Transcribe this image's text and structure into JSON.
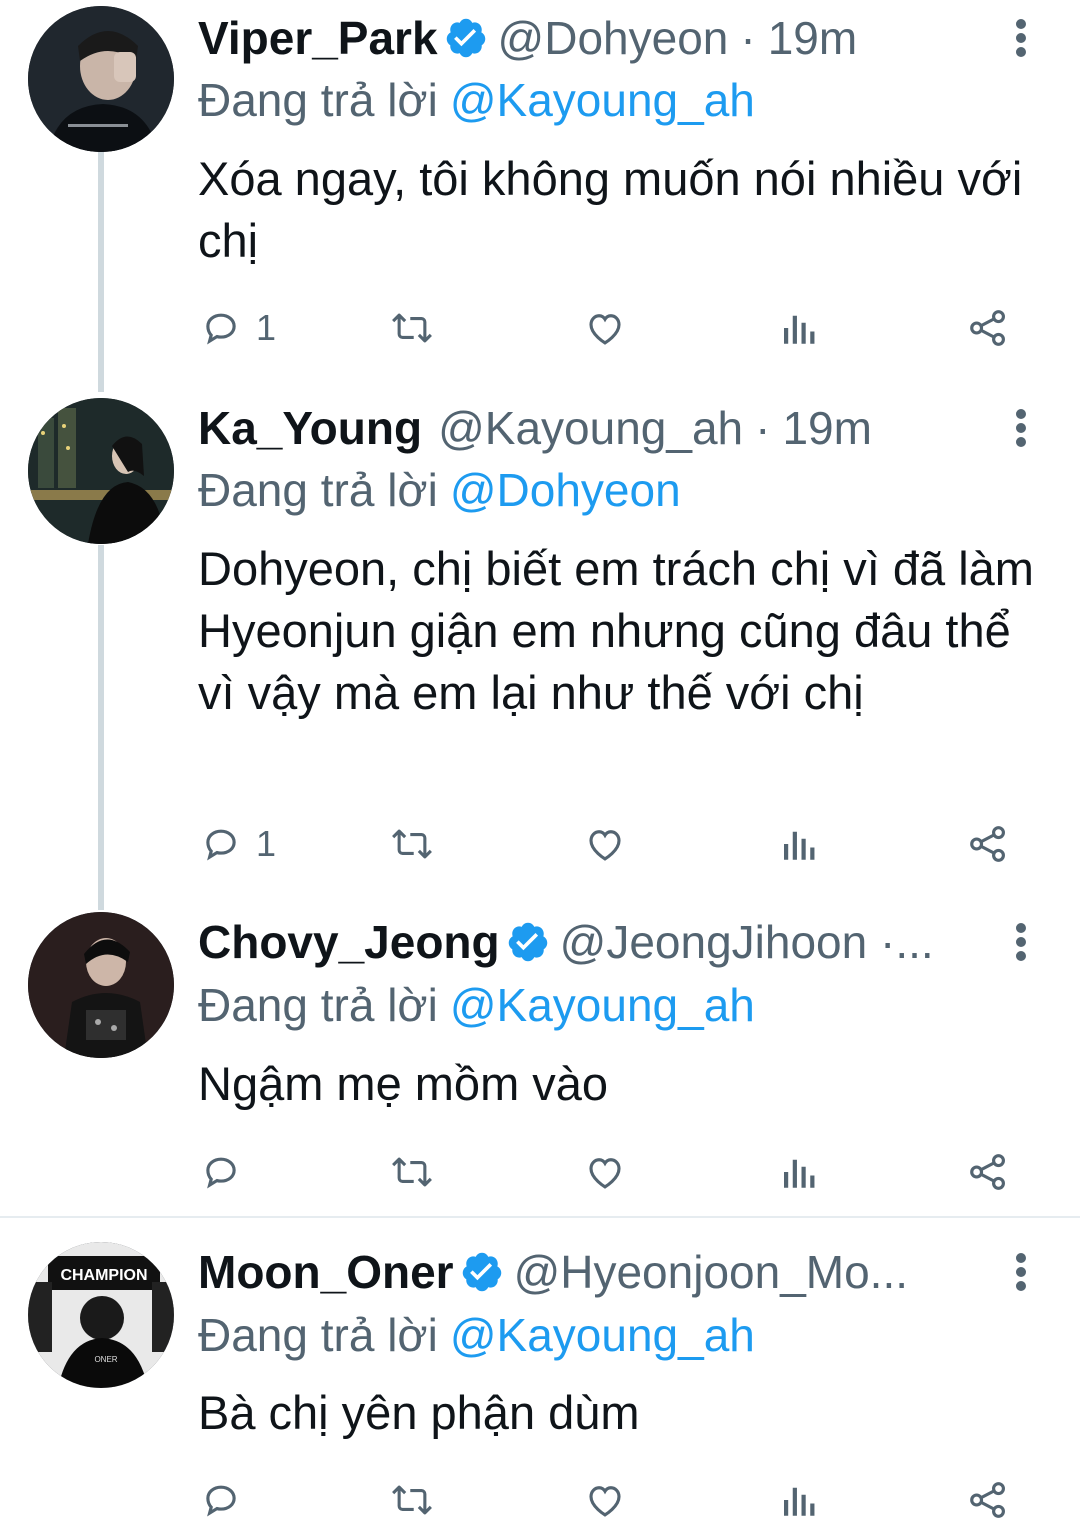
{
  "tweets": [
    {
      "display_name": "Viper_Park",
      "verified": true,
      "handle": "@Dohyeon",
      "time": "19m",
      "reply_prefix": "Đang trả lời",
      "reply_to": "@Kayoung_ah",
      "text": "Xóa ngay, tôi không muốn nói nhiều với chị",
      "reply_count": "1",
      "avatar": "dark-portrait-hand-on-face"
    },
    {
      "display_name": "Ka_Young",
      "verified": false,
      "handle": "@Kayoung_ah",
      "time": "19m",
      "reply_prefix": "Đang trả lời",
      "reply_to": "@Dohyeon",
      "text": "Dohyeon, chị biết em trách chị vì đã làm Hyeonjun giận em nhưng cũng đâu thể vì vậy mà em lại như thế với chị",
      "reply_count": "1",
      "avatar": "night-city-silhouette"
    },
    {
      "display_name": "Chovy_Jeong",
      "verified": true,
      "handle": "@JeongJihoon ·...",
      "time": "",
      "reply_prefix": "Đang trả lời",
      "reply_to": "@Kayoung_ah",
      "text": "Ngậm mẹ mồm vào",
      "reply_count": "",
      "avatar": "stage-portrait"
    },
    {
      "display_name": "Moon_Oner",
      "verified": true,
      "handle": "@Hyeonjoon_Mo...",
      "time": "",
      "reply_prefix": "Đang trả lời",
      "reply_to": "@Kayoung_ah",
      "text": "Bà chị yên phận dùm",
      "reply_count": "",
      "avatar": "champion-banner-portrait"
    }
  ],
  "icons": {
    "reply": "reply-icon",
    "retweet": "retweet-icon",
    "like": "like-icon",
    "views": "views-icon",
    "share": "share-icon",
    "more": "more-vertical-icon",
    "verified": "verified-badge-icon"
  },
  "colors": {
    "mention": "#1d9bf0",
    "verified": "#1d9bf0",
    "secondary_text": "#536471",
    "thread_line": "#cfd9de"
  }
}
